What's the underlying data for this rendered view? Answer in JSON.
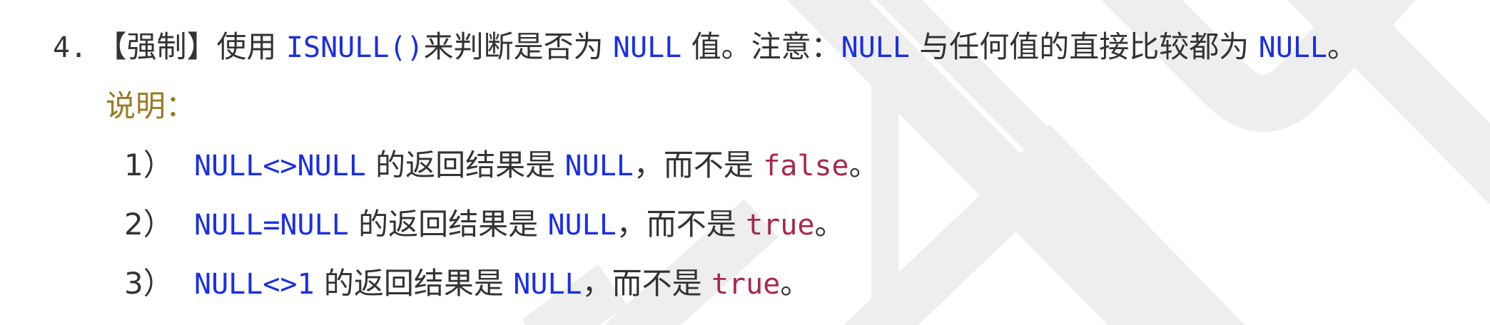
{
  "rule": {
    "number": "4.",
    "tag": "【强制】",
    "text_1": "使用 ",
    "code_isnull": "ISNULL()",
    "text_2": "来判断是否为 ",
    "code_null_1": "NULL",
    "text_3": " 值。注意：",
    "code_null_2": "NULL",
    "text_4": " 与任何值的直接比较都为 ",
    "code_null_3": "NULL",
    "text_5": "。"
  },
  "note_label": "说明：",
  "items": [
    {
      "marker": "1）",
      "expr": "NULL<>NULL",
      "text_1": " 的返回结果是 ",
      "result": "NULL",
      "text_2": "，而不是 ",
      "not_value": "false",
      "end": "。"
    },
    {
      "marker": "2）",
      "expr": "NULL=NULL",
      "text_1": " 的返回结果是 ",
      "result": "NULL",
      "text_2": "，而不是 ",
      "not_value": "true",
      "end": "。"
    },
    {
      "marker": "3）",
      "expr": "NULL<>1",
      "text_1": " 的返回结果是 ",
      "result": "NULL",
      "text_2": "，而不是 ",
      "not_value": "true",
      "end": "。"
    }
  ],
  "colors": {
    "text": "#333333",
    "code_blue": "#1a2ee6",
    "value_red": "#a8284a",
    "note_olive": "#9a7a25",
    "watermark": "#eeeeee"
  }
}
